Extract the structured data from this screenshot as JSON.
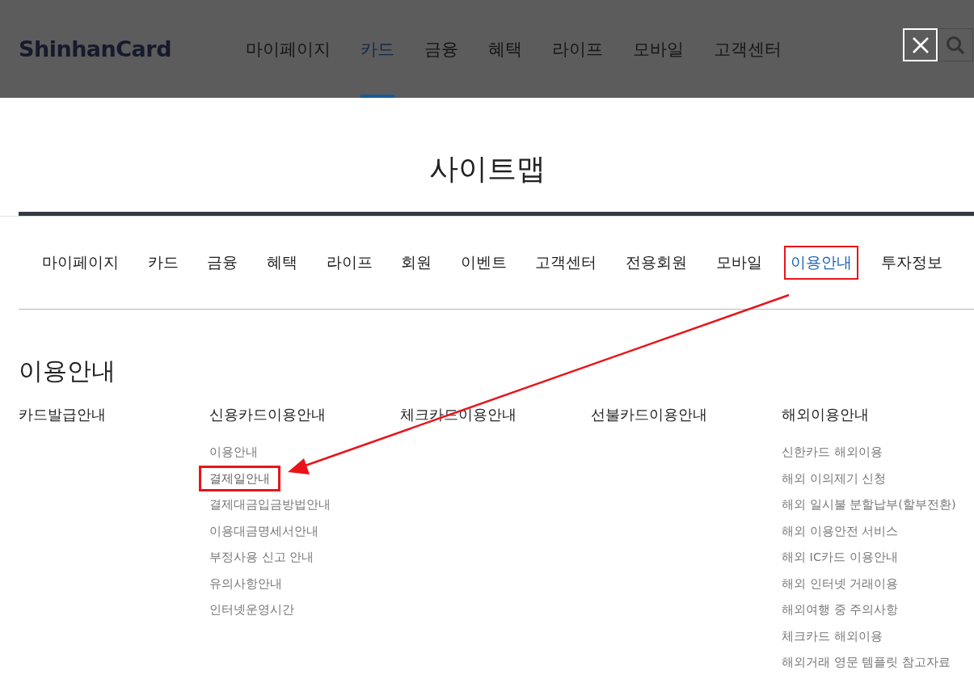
{
  "header": {
    "logo": "ShinhanCard",
    "nav": [
      {
        "label": "마이페이지",
        "selected": false
      },
      {
        "label": "카드",
        "selected": true
      },
      {
        "label": "금융",
        "selected": false
      },
      {
        "label": "혜택",
        "selected": false
      },
      {
        "label": "라이프",
        "selected": false
      },
      {
        "label": "모바일",
        "selected": false
      },
      {
        "label": "고객센터",
        "selected": false
      }
    ]
  },
  "sitemap": {
    "title": "사이트맵",
    "tabs": [
      {
        "label": "마이페이지",
        "selected": false,
        "highlighted": false
      },
      {
        "label": "카드",
        "selected": false,
        "highlighted": false
      },
      {
        "label": "금융",
        "selected": false,
        "highlighted": false
      },
      {
        "label": "혜택",
        "selected": false,
        "highlighted": false
      },
      {
        "label": "라이프",
        "selected": false,
        "highlighted": false
      },
      {
        "label": "회원",
        "selected": false,
        "highlighted": false
      },
      {
        "label": "이벤트",
        "selected": false,
        "highlighted": false
      },
      {
        "label": "고객센터",
        "selected": false,
        "highlighted": false
      },
      {
        "label": "전용회원",
        "selected": false,
        "highlighted": false
      },
      {
        "label": "모바일",
        "selected": false,
        "highlighted": false
      },
      {
        "label": "이용안내",
        "selected": true,
        "highlighted": true
      },
      {
        "label": "투자정보",
        "selected": false,
        "highlighted": false
      }
    ],
    "section_title": "이용안내",
    "columns": [
      {
        "heading": "카드발급안내"
      },
      {
        "heading": "신용카드이용안내",
        "items": [
          {
            "label": "이용안내",
            "highlighted": false
          },
          {
            "label": "결제일안내",
            "highlighted": true
          },
          {
            "label": "결제대금입금방법안내",
            "highlighted": false
          },
          {
            "label": "이용대금명세서안내",
            "highlighted": false
          },
          {
            "label": "부정사용 신고 안내",
            "highlighted": false
          },
          {
            "label": "유의사항안내",
            "highlighted": false
          },
          {
            "label": "인터넷운영시간",
            "highlighted": false
          }
        ]
      },
      {
        "heading": "체크카드이용안내"
      },
      {
        "heading": "선불카드이용안내"
      },
      {
        "heading": "해외이용안내",
        "items": [
          {
            "label": "신한카드 해외이용",
            "highlighted": false
          },
          {
            "label": "해외 이의제기 신청",
            "highlighted": false
          },
          {
            "label": "해외 일시불 분할납부(할부전환)",
            "highlighted": false
          },
          {
            "label": "해외 이용안전 서비스",
            "highlighted": false
          },
          {
            "label": "해외 IC카드 이용안내",
            "highlighted": false
          },
          {
            "label": "해외 인터넷 거래이용",
            "highlighted": false
          },
          {
            "label": "해외여행 중 주의사항",
            "highlighted": false
          },
          {
            "label": "체크카드 해외이용",
            "highlighted": false
          },
          {
            "label": "해외거래 영문 템플릿 참고자료",
            "highlighted": false
          }
        ]
      }
    ]
  }
}
